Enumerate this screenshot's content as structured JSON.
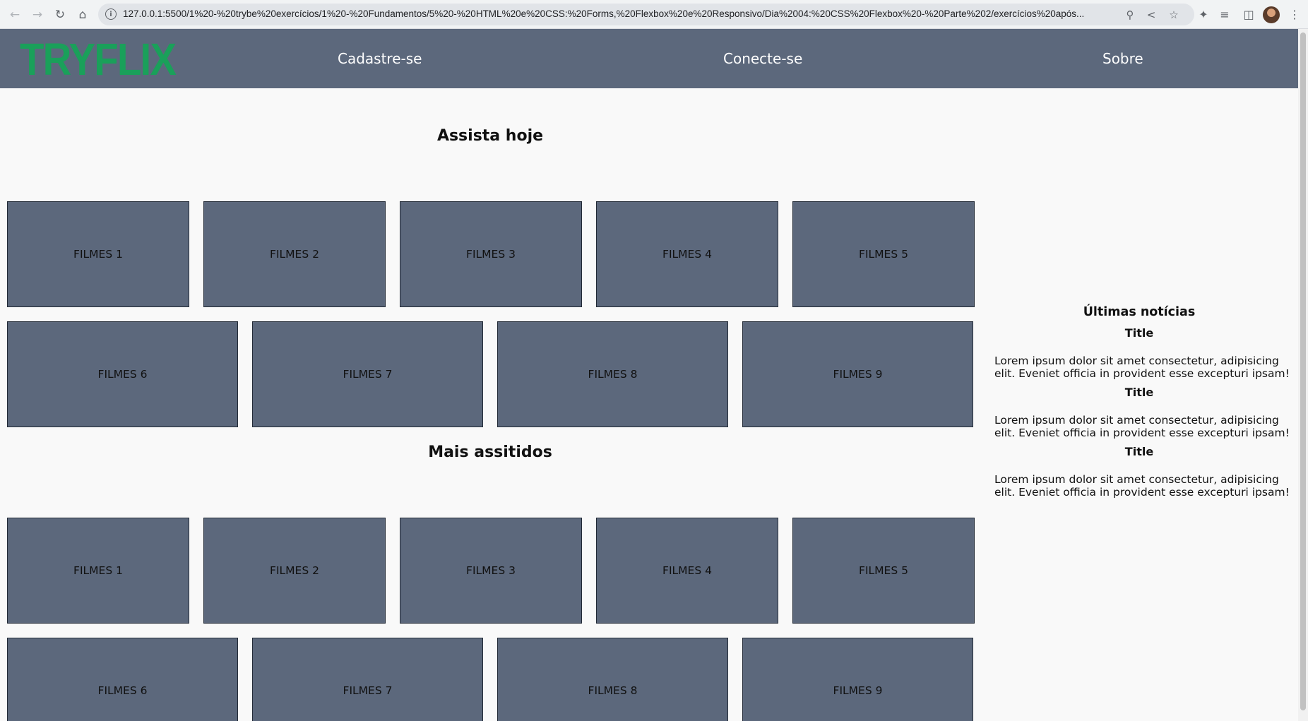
{
  "browser": {
    "url": "127.0.0.1:5500/1%20-%20trybe%20exercícios/1%20-%20Fundamentos/5%20-%20HTML%20e%20CSS:%20Forms,%20Flexbox%20e%20Responsivo/Dia%2004:%20CSS%20Flexbox%20-%20Parte%202/exercícios%20após..."
  },
  "header": {
    "logo": "TRYFLIX",
    "nav": [
      "Cadastre-se",
      "Conecte-se",
      "Sobre"
    ]
  },
  "sections": [
    {
      "title": "Assista hoje",
      "row1": [
        "FILMES 1",
        "FILMES 2",
        "FILMES 3",
        "FILMES 4",
        "FILMES 5"
      ],
      "row2": [
        "FILMES 6",
        "FILMES 7",
        "FILMES 8",
        "FILMES 9"
      ]
    },
    {
      "title": "Mais assitidos",
      "row1": [
        "FILMES 1",
        "FILMES 2",
        "FILMES 3",
        "FILMES 4",
        "FILMES 5"
      ],
      "row2": [
        "FILMES 6",
        "FILMES 7",
        "FILMES 8",
        "FILMES 9"
      ]
    }
  ],
  "aside": {
    "title": "Últimas notícias",
    "news": [
      {
        "title": "Title",
        "text": "Lorem ipsum dolor sit amet consectetur, adipisicing elit. Eveniet officia in provident esse excepturi ipsam!"
      },
      {
        "title": "Title",
        "text": "Lorem ipsum dolor sit amet consectetur, adipisicing elit. Eveniet officia in provident esse excepturi ipsam!"
      },
      {
        "title": "Title",
        "text": "Lorem ipsum dolor sit amet consectetur, adipisicing elit. Eveniet officia in provident esse excepturi ipsam!"
      }
    ]
  },
  "colors": {
    "header_bg": "#5c687c",
    "logo": "#1aa05a",
    "card_bg": "#5c687c",
    "page_bg": "#f9f9f9"
  }
}
